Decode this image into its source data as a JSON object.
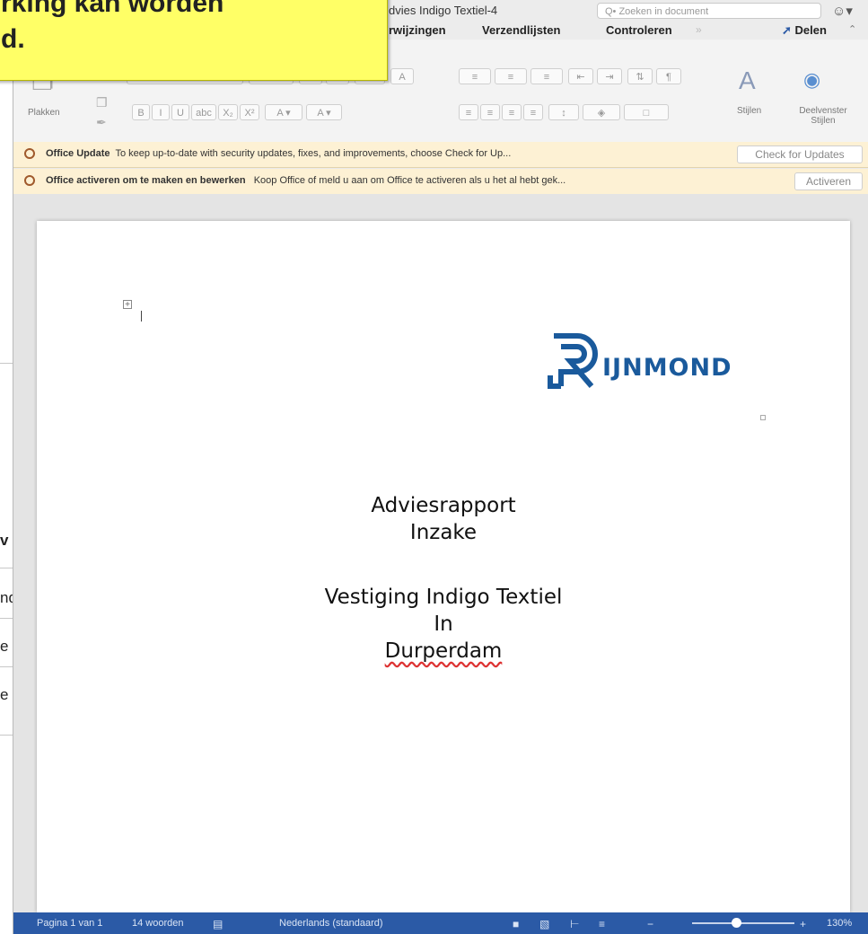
{
  "callout": {
    "line1": "rking kan worden",
    "line2": "d."
  },
  "window": {
    "title": "dvies Indigo Textiel-4",
    "search_placeholder": "Q• Zoeken in document",
    "user_icon": "person-circle-icon"
  },
  "tabs": [
    "rwijzingen",
    "Verzendlijsten",
    "Controleren"
  ],
  "share_label": "Delen",
  "ribbon": {
    "paste_label": "Plakken",
    "styles_label": "Stijlen",
    "styles_pane_label": "Deelvenster Stijlen",
    "font_buttons": [
      "B",
      "I",
      "U",
      "abc",
      "X₂",
      "X²"
    ]
  },
  "messages": [
    {
      "title": "Office Update",
      "text": "To keep up-to-date with security updates, fixes, and improvements, choose Check for Up...",
      "button": "Check for Updates"
    },
    {
      "title": "Office activeren om te maken en bewerken",
      "text": "Koop Office of meld u aan om Office te activeren als u het al hebt gek...",
      "button": "Activeren"
    }
  ],
  "left_fragments": [
    "v",
    "nd",
    "e",
    "e"
  ],
  "document": {
    "logo_text": "IJNMOND",
    "lines": [
      "Adviesrapport",
      "Inzake",
      "Vestiging Indigo Textiel",
      "In",
      "Durperdam"
    ]
  },
  "status": {
    "page": "Pagina 1 van 1",
    "words": "14 woorden",
    "language": "Nederlands (standaard)",
    "zoom": "130%",
    "zoom_level_percent": 130
  },
  "colors": {
    "status_bar": "#2b5aa6",
    "logo": "#1a5a9c",
    "callout": "#ffff66",
    "message_bar": "#fdf1d4"
  }
}
